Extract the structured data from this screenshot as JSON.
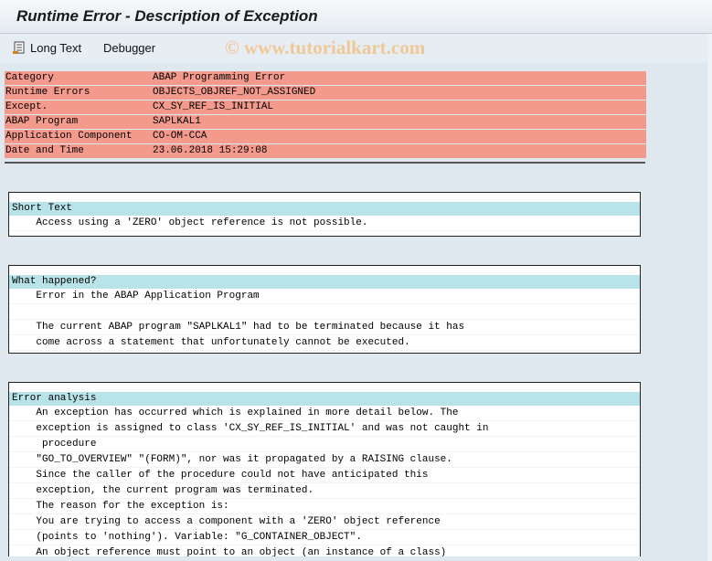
{
  "window": {
    "title": "Runtime Error - Description of Exception"
  },
  "toolbar": {
    "long_text_label": "Long Text",
    "debugger_label": "Debugger"
  },
  "watermark": "© www.tutorialkart.com",
  "header": {
    "rows": [
      {
        "key": "Category",
        "value": "ABAP Programming Error"
      },
      {
        "key": "Runtime Errors",
        "value": "OBJECTS_OBJREF_NOT_ASSIGNED"
      },
      {
        "key": "Except.",
        "value": "CX_SY_REF_IS_INITIAL"
      },
      {
        "key": "ABAP Program",
        "value": "SAPLKAL1"
      },
      {
        "key": "Application Component",
        "value": "CO-OM-CCA"
      },
      {
        "key": "Date and Time",
        "value": "23.06.2018 15:29:08"
      }
    ]
  },
  "short_text": {
    "title": "Short Text",
    "lines": [
      "    Access using a 'ZERO' object reference is not possible."
    ]
  },
  "what_happened": {
    "title": "What happened?",
    "lines": [
      "    Error in the ABAP Application Program",
      "",
      "    The current ABAP program \"SAPLKAL1\" had to be terminated because it has",
      "    come across a statement that unfortunately cannot be executed."
    ]
  },
  "error_analysis": {
    "title": "Error analysis",
    "lines": [
      "    An exception has occurred which is explained in more detail below. The",
      "    exception is assigned to class 'CX_SY_REF_IS_INITIAL' and was not caught in",
      "     procedure",
      "    \"GO_TO_OVERVIEW\" \"(FORM)\", nor was it propagated by a RAISING clause.",
      "    Since the caller of the procedure could not have anticipated this",
      "    exception, the current program was terminated.",
      "    The reason for the exception is:",
      "    You are trying to access a component with a 'ZERO' object reference",
      "    (points to 'nothing'). Variable: \"G_CONTAINER_OBJECT\".",
      "    An object reference must point to an object (an instance of a class)"
    ]
  }
}
